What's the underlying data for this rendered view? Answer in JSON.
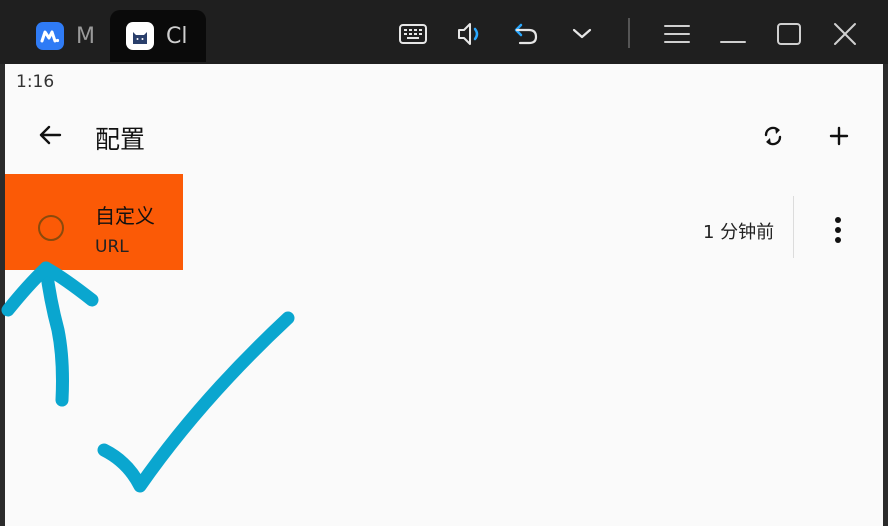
{
  "window": {
    "tabs": [
      {
        "label": "M",
        "icon": "blue-m-app-icon"
      },
      {
        "label": "Cl",
        "icon": "clash-cat-app-icon"
      }
    ],
    "controls": [
      "keyboard-icon",
      "volume-icon",
      "undo-icon",
      "chevron-down-icon",
      "menu-icon",
      "minimize-icon",
      "maximize-icon",
      "close-icon"
    ]
  },
  "status": {
    "time": "1:16"
  },
  "appbar": {
    "title": "配置"
  },
  "profile": {
    "name": "自定义",
    "type": "URL",
    "updated": "1 分钟前"
  },
  "colors": {
    "highlight": "#fb5a06",
    "annotation": "#0aa6cf",
    "titlebar": "#1f1f1f",
    "screen": "#fafafa"
  }
}
